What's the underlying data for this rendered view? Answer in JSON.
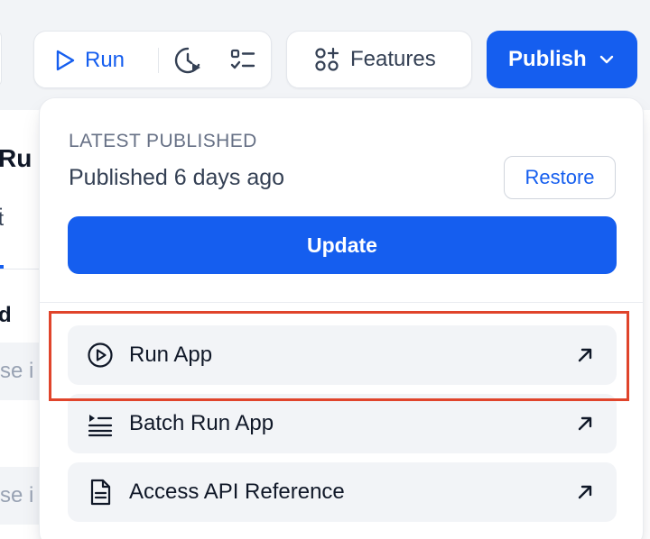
{
  "toolbar": {
    "run_label": "Run",
    "features_label": "Features",
    "publish_label": "Publish"
  },
  "background": {
    "title_fragment": "Ru",
    "field_label_fragment": "d",
    "placeholder_fragment": "se i"
  },
  "popover": {
    "kicker": "LATEST PUBLISHED",
    "status": "Published 6 days ago",
    "restore_label": "Restore",
    "update_label": "Update",
    "items": [
      {
        "label": "Run App",
        "icon": "play-circle-icon"
      },
      {
        "label": "Batch Run App",
        "icon": "batch-list-icon"
      },
      {
        "label": "Access API Reference",
        "icon": "document-icon"
      }
    ]
  },
  "colors": {
    "accent": "#155eef",
    "highlight": "#e0442b"
  }
}
